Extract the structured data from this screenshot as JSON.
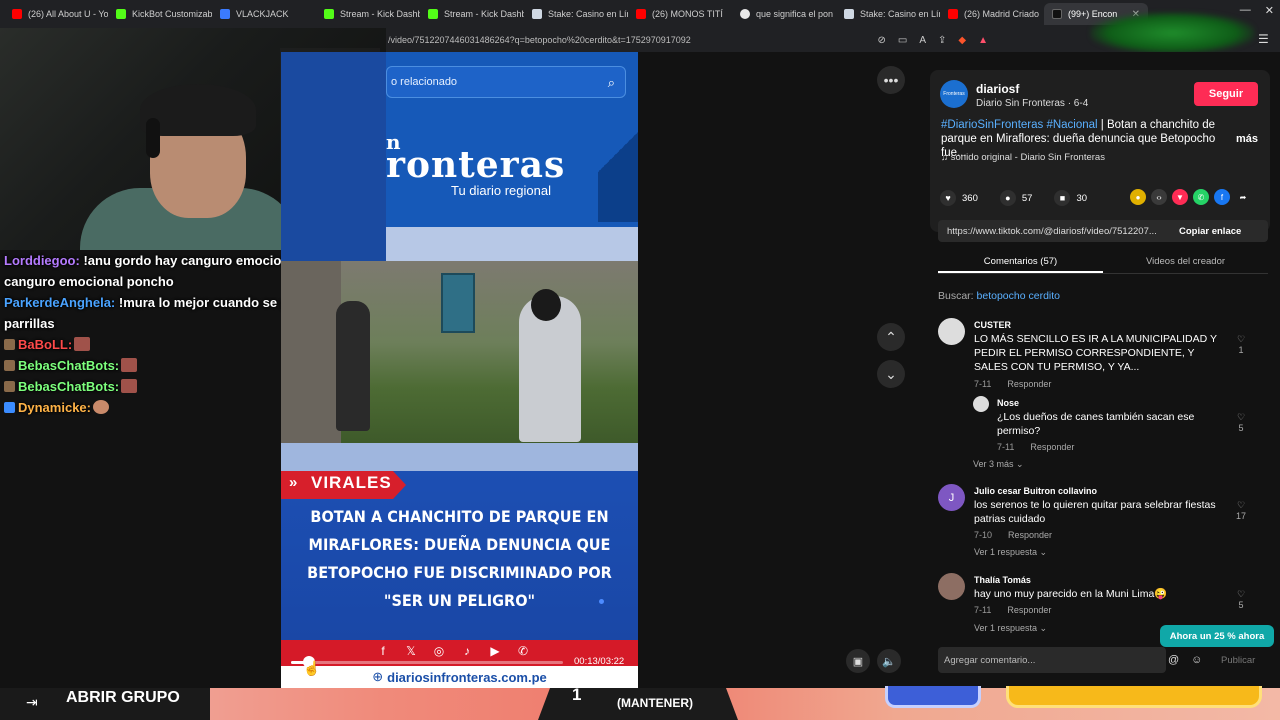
{
  "browser": {
    "tabs": [
      {
        "label": "(26) All About U - Yo",
        "color": "#ff0000"
      },
      {
        "label": "KickBot Customizabl",
        "color": "#53fc18"
      },
      {
        "label": "VLACKJACK",
        "color": "#3b7bff"
      },
      {
        "label": "Stream - Kick Dashb",
        "color": "#53fc18"
      },
      {
        "label": "Stream - Kick Dashb",
        "color": "#53fc18"
      },
      {
        "label": "Stake: Casino en Lín",
        "color": "#cfd8e3"
      },
      {
        "label": "(26) MONOS TITÍ",
        "color": "#ff0000"
      },
      {
        "label": "que significa el pon",
        "color": "#e8e8e8"
      },
      {
        "label": "Stake: Casino en Lín",
        "color": "#cfd8e3"
      },
      {
        "label": "(26) Madrid Criado",
        "color": "#ff0000"
      },
      {
        "label": "(99+) Encon",
        "color": "#111111"
      }
    ],
    "url": "/video/7512207446031486264?q=betopocho%20cerdito&t=1752970917092"
  },
  "chat": {
    "messages": [
      {
        "user": "Lorddiegoo:",
        "user_color": "#b57bff",
        "text": " !anu gordo hay canguro emocional buscado hay canguro emocional poncho"
      },
      {
        "user": "ParkerdeAnghela:",
        "user_color": "#4aa3ff",
        "text": " !mura lo mejor cuando se porta mal te lo parrillas"
      },
      {
        "user": "BaBoLL:",
        "user_color": "#ff4a4a",
        "text": ""
      },
      {
        "user": "BebasChatBots:",
        "user_color": "#7dff7d",
        "text": ""
      },
      {
        "user": "BebasChatBots:",
        "user_color": "#7dff7d",
        "text": ""
      },
      {
        "user": "Dynamicke:",
        "user_color": "#ffb347",
        "text": ""
      }
    ]
  },
  "video": {
    "search_text": "o relacionado",
    "brand_n": "n",
    "brand": "ronteras",
    "tagline": "Tu diario regional",
    "badge": "VIRALES",
    "headline": "BOTAN A CHANCHITO DE PARQUE EN MIRAFLORES: DUEÑA DENUNCIA QUE BETOPOCHO FUE DISCRIMINADO POR \"SER UN PELIGRO\"",
    "social_icons": [
      "f",
      "𝕏",
      "◎",
      "♪",
      "▶",
      "✆"
    ],
    "time": "00:13/03:22",
    "progress": 0.065,
    "site": "diariosinfronteras.com.pe"
  },
  "panel": {
    "author": "diariosf",
    "author_sub": "Diario Sin Fronteras · 6-4",
    "avatar_text": "Fronteras",
    "follow": "Seguir",
    "hashtags": "#DiarioSinFronteras #Nacional",
    "desc": " | Botan a chanchito de parque en Miraflores: dueña denuncia que Betopocho fue...",
    "more": "más",
    "sound": "♫  sonido original - Diario Sin Fronteras",
    "likes": "360",
    "comments_count": "57",
    "saves": "30",
    "link": "https://www.tiktok.com/@diariosf/video/7512207...",
    "copy_link": "Copiar enlace",
    "tab_comments": "Comentarios (57)",
    "tab_creator": "Videos del creador",
    "search_label": "Buscar: ",
    "search_query": "betopocho cerdito",
    "comments": [
      {
        "user": "CUSTER",
        "text": "LO MÁS SENCILLO ES IR A LA MUNICIPALIDAD Y PEDIR EL PERMISO CORRESPONDIENTE, Y SALES CON TU PERMISO, Y YA...",
        "date": "7-11",
        "reply": "Responder",
        "likes": "1"
      },
      {
        "user": "Nose",
        "text": "¿Los dueños de canes también sacan ese permiso?",
        "date": "7-11",
        "reply": "Responder",
        "likes": "5",
        "more": "Ver 3 más ⌄"
      },
      {
        "user": "Julio cesar Buitron collavino",
        "avatar": "J",
        "text": "los serenos te lo quieren quitar para selebrar fiestas patrias cuidado",
        "date": "7-10",
        "reply": "Responder",
        "likes": "17",
        "more": "Ver 1 respuesta ⌄"
      },
      {
        "user": "Thalía Tomás",
        "text": "hay uno muy parecido en la Muni Lima😜",
        "date": "7-11",
        "reply": "Responder",
        "likes": "5",
        "more": "Ver 1 respuesta ⌄"
      }
    ],
    "input_placeholder": "Agregar comentario...",
    "publish": "Publicar",
    "promo": "Ahora un 25 % ahora"
  },
  "bottom": {
    "group": "ABRIR GRUPO",
    "number": "1",
    "mantener": "(MANTENER)"
  }
}
